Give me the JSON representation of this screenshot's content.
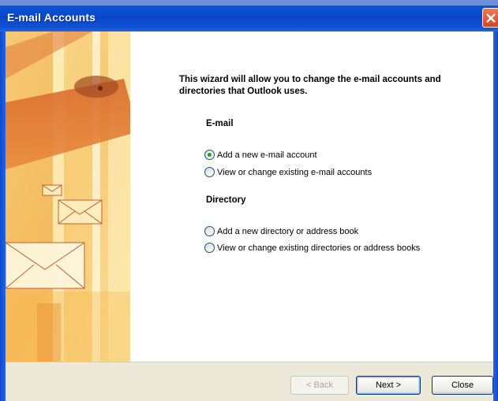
{
  "window": {
    "title": "E-mail Accounts",
    "close_icon": "close-icon"
  },
  "wizard": {
    "intro_text": "This wizard will allow you to change the e-mail accounts and directories that Outlook uses.",
    "email_section": {
      "label": "E-mail",
      "options": [
        {
          "label": "Add a new e-mail account",
          "checked": true
        },
        {
          "label": "View or change existing e-mail accounts",
          "checked": false
        }
      ]
    },
    "directory_section": {
      "label": "Directory",
      "options": [
        {
          "label": "Add a new directory or address book",
          "checked": false
        },
        {
          "label": "View or change existing directories or address books",
          "checked": false
        }
      ]
    }
  },
  "buttons": {
    "back": "< Back",
    "next": "Next >",
    "close": "Close"
  },
  "colors": {
    "title_bar": "#0a47c8",
    "close_button": "#d8431c",
    "radio_selected": "#21a121",
    "button_bar": "#ece9d8"
  }
}
